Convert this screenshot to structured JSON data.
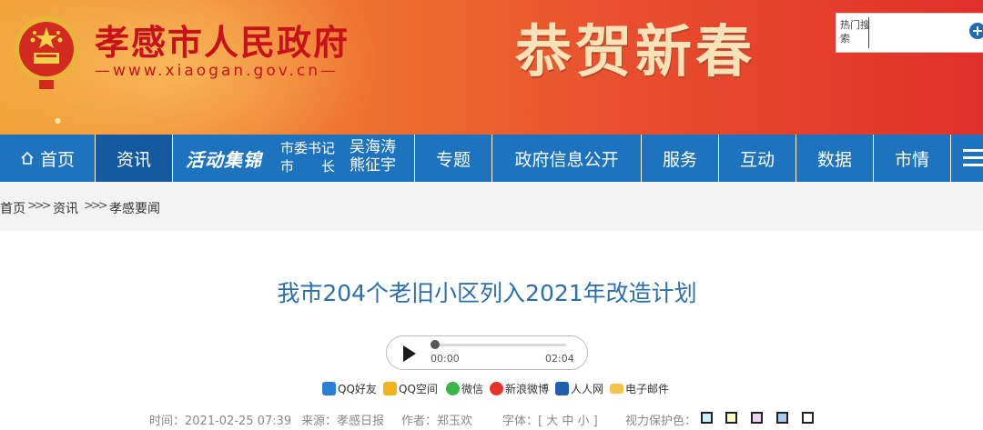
{
  "header": {
    "site_name": "孝感市人民政府",
    "site_url": "—www.xiaogan.gov.cn—",
    "greeting": "恭贺新春",
    "search": {
      "label": "热门搜索",
      "placeholder": ""
    }
  },
  "nav": {
    "items": [
      "首页",
      "资讯",
      "活动集锦",
      "专题",
      "政府信息公开",
      "服务",
      "互动",
      "数据",
      "市情"
    ],
    "active": "资讯",
    "leaders": {
      "secretary_title": "市委书记",
      "secretary_name": "吴海涛",
      "mayor_title": "市　　长",
      "mayor_name": "熊征宇"
    }
  },
  "breadcrumb": [
    "首页",
    "资讯",
    "孝感要闻"
  ],
  "breadcrumb_sep": ">>>",
  "article": {
    "title": "我市204个老旧小区列入2021年改造计划",
    "audio": {
      "current": "00:00",
      "duration": "02:04",
      "progress": 0
    },
    "share": [
      "QQ好友",
      "QQ空间",
      "微信",
      "新浪微博",
      "人人网",
      "电子邮件"
    ],
    "meta": {
      "time": "时间：2021-02-25 07:39",
      "source": "来源：孝感日报",
      "author": "作者：郑玉欢",
      "font_size": "字体：[ 大 中 小 ]",
      "eye_care": "视力保护色："
    },
    "eye_care_colors": [
      "#cdefff",
      "#fff6c6",
      "#f2d2f2",
      "#a9c9f2",
      "#ffffff"
    ]
  },
  "colors": {
    "nav_bg": "#1e73be",
    "nav_active": "#1559a0",
    "title_blue": "#2a6fad",
    "banner_red": "#c8121b"
  }
}
